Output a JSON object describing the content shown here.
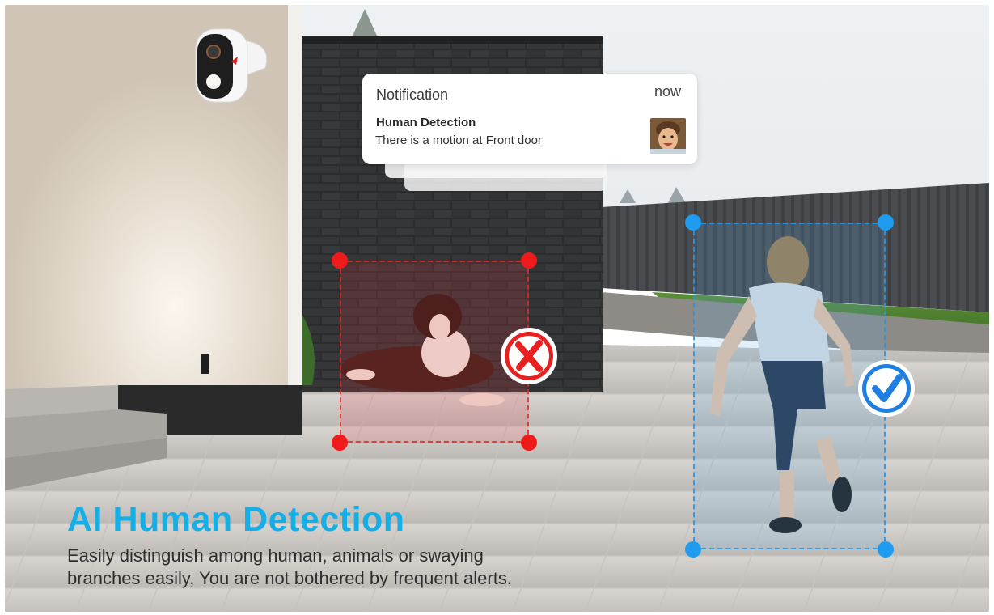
{
  "notification": {
    "header": "Notification",
    "time": "now",
    "title": "Human Detection",
    "message": "There is a motion at Front door"
  },
  "detections": [
    {
      "subject": "dog",
      "result": "rejected",
      "color": "#ef1b1b"
    },
    {
      "subject": "child",
      "result": "accepted",
      "color": "#1f9cf0"
    }
  ],
  "caption": {
    "title": "AI Human Detection",
    "body_line1": "Easily distinguish among human, animals or swaying",
    "body_line2": "branches easily, You are not bothered by frequent alerts."
  },
  "colors": {
    "accent": "#16aee6",
    "reject": "#ef1b1b",
    "accept": "#1f9cf0"
  },
  "icons": [
    "camera-icon",
    "reject-x-icon",
    "accept-check-icon"
  ]
}
